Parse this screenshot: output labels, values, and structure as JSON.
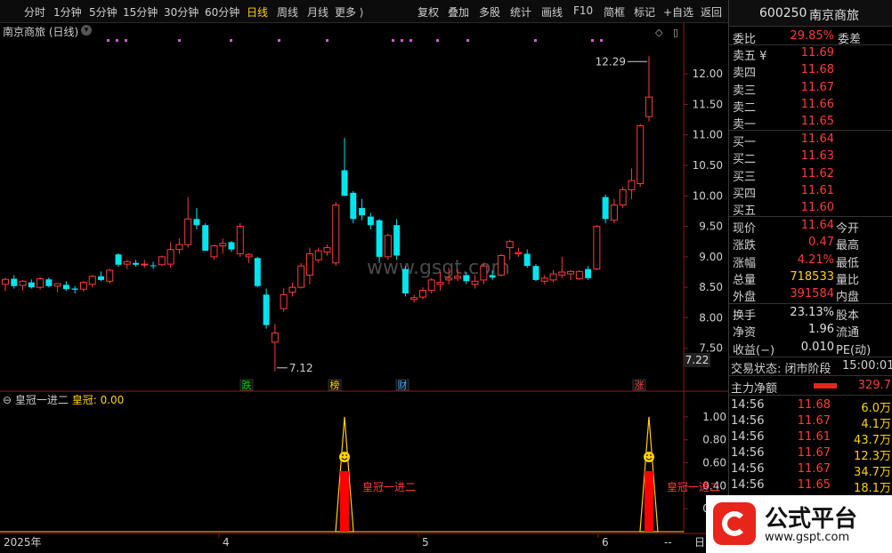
{
  "toolbar": {
    "items": [
      {
        "label": "分时",
        "x": 27
      },
      {
        "label": "1分钟",
        "x": 60
      },
      {
        "label": "5分钟",
        "x": 100
      },
      {
        "label": "15分钟",
        "x": 138
      },
      {
        "label": "30分钟",
        "x": 184
      },
      {
        "label": "60分钟",
        "x": 230
      },
      {
        "label": "日线",
        "x": 277,
        "active": true
      },
      {
        "label": "周线",
        "x": 311
      },
      {
        "label": "月线",
        "x": 345
      },
      {
        "label": "更多 ⟩",
        "x": 376
      },
      {
        "label": "复权",
        "x": 469
      },
      {
        "label": "叠加",
        "x": 503
      },
      {
        "label": "多股",
        "x": 538
      },
      {
        "label": "统计",
        "x": 573
      },
      {
        "label": "画线",
        "x": 608
      },
      {
        "label": "F10",
        "x": 644
      },
      {
        "label": "简框",
        "x": 678
      },
      {
        "label": "标记",
        "x": 712
      },
      {
        "label": "+自选",
        "x": 745
      },
      {
        "label": "返回",
        "x": 787
      }
    ]
  },
  "chart": {
    "title": "南京商旅 (日线)",
    "high_label": "12.29",
    "low_label": "7.12",
    "last_price_label": "7.22",
    "watermark": "www.gsgt.com",
    "markers": [
      {
        "label": "跌",
        "color": "#00d200"
      },
      {
        "label": "榜",
        "color": "#ffd200"
      },
      {
        "label": "财",
        "color": "#3aa8ff"
      },
      {
        "label": "涨",
        "color": "#ff3b3b"
      }
    ],
    "indicator_name": "皇冠一进二",
    "indicator_value_label": "皇冠: 0.00",
    "signal_text": "皇冠一进二",
    "x_labels": [
      "2025年",
      "4",
      "5",
      "6"
    ],
    "bottom_right": [
      "--",
      "日"
    ]
  },
  "chart_data": [
    {
      "type": "candlestick",
      "title": "南京商旅 (日线)",
      "ylim": [
        7.0,
        12.6
      ],
      "y_ticks": [
        7.5,
        8.0,
        8.5,
        9.0,
        9.5,
        10.0,
        10.5,
        11.0,
        11.5,
        12.0
      ],
      "candles": [
        {
          "o": 8.55,
          "h": 8.66,
          "l": 8.44,
          "c": 8.63
        },
        {
          "o": 8.64,
          "h": 8.7,
          "l": 8.48,
          "c": 8.52
        },
        {
          "o": 8.53,
          "h": 8.62,
          "l": 8.45,
          "c": 8.6
        },
        {
          "o": 8.58,
          "h": 8.63,
          "l": 8.48,
          "c": 8.5
        },
        {
          "o": 8.5,
          "h": 8.67,
          "l": 8.46,
          "c": 8.64
        },
        {
          "o": 8.63,
          "h": 8.66,
          "l": 8.5,
          "c": 8.52
        },
        {
          "o": 8.52,
          "h": 8.57,
          "l": 8.42,
          "c": 8.56
        },
        {
          "o": 8.54,
          "h": 8.6,
          "l": 8.44,
          "c": 8.47
        },
        {
          "o": 8.48,
          "h": 8.52,
          "l": 8.4,
          "c": 8.46
        },
        {
          "o": 8.47,
          "h": 8.6,
          "l": 8.43,
          "c": 8.58
        },
        {
          "o": 8.55,
          "h": 8.7,
          "l": 8.5,
          "c": 8.68
        },
        {
          "o": 8.68,
          "h": 8.76,
          "l": 8.6,
          "c": 8.62
        },
        {
          "o": 8.6,
          "h": 8.8,
          "l": 8.56,
          "c": 8.78
        },
        {
          "o": 9.04,
          "h": 9.06,
          "l": 8.84,
          "c": 8.87
        },
        {
          "o": 8.88,
          "h": 8.95,
          "l": 8.8,
          "c": 8.92
        },
        {
          "o": 8.9,
          "h": 8.95,
          "l": 8.84,
          "c": 8.87
        },
        {
          "o": 8.87,
          "h": 8.95,
          "l": 8.82,
          "c": 8.88
        },
        {
          "o": 8.86,
          "h": 8.92,
          "l": 8.8,
          "c": 8.85
        },
        {
          "o": 8.87,
          "h": 9.02,
          "l": 8.85,
          "c": 9.0
        },
        {
          "o": 8.88,
          "h": 9.24,
          "l": 8.82,
          "c": 9.12
        },
        {
          "o": 9.12,
          "h": 9.3,
          "l": 9.05,
          "c": 9.2
        },
        {
          "o": 9.2,
          "h": 9.98,
          "l": 9.15,
          "c": 9.62
        },
        {
          "o": 9.62,
          "h": 9.8,
          "l": 9.45,
          "c": 9.52
        },
        {
          "o": 9.52,
          "h": 9.55,
          "l": 9.1,
          "c": 9.1
        },
        {
          "o": 9.0,
          "h": 9.2,
          "l": 8.95,
          "c": 9.18
        },
        {
          "o": 9.18,
          "h": 9.3,
          "l": 9.05,
          "c": 9.22
        },
        {
          "o": 9.24,
          "h": 9.26,
          "l": 9.08,
          "c": 9.12
        },
        {
          "o": 9.05,
          "h": 9.55,
          "l": 9.0,
          "c": 9.5
        },
        {
          "o": 9.0,
          "h": 9.06,
          "l": 8.9,
          "c": 9.04
        },
        {
          "o": 8.98,
          "h": 9.0,
          "l": 8.5,
          "c": 8.52
        },
        {
          "o": 8.38,
          "h": 8.48,
          "l": 7.82,
          "c": 7.88
        },
        {
          "o": 7.6,
          "h": 7.9,
          "l": 7.12,
          "c": 7.75
        },
        {
          "o": 8.15,
          "h": 8.48,
          "l": 8.1,
          "c": 8.38
        },
        {
          "o": 8.42,
          "h": 8.58,
          "l": 8.35,
          "c": 8.5
        },
        {
          "o": 8.5,
          "h": 8.9,
          "l": 8.48,
          "c": 8.85
        },
        {
          "o": 8.7,
          "h": 9.15,
          "l": 8.55,
          "c": 9.05
        },
        {
          "o": 8.95,
          "h": 9.15,
          "l": 8.9,
          "c": 9.1
        },
        {
          "o": 9.08,
          "h": 9.2,
          "l": 9.02,
          "c": 9.15
        },
        {
          "o": 8.9,
          "h": 9.9,
          "l": 8.85,
          "c": 9.85
        },
        {
          "o": 10.42,
          "h": 10.95,
          "l": 10.12,
          "c": 10.0
        },
        {
          "o": 10.05,
          "h": 10.08,
          "l": 9.55,
          "c": 9.62
        },
        {
          "o": 9.8,
          "h": 9.95,
          "l": 9.6,
          "c": 9.68
        },
        {
          "o": 9.66,
          "h": 9.72,
          "l": 9.45,
          "c": 9.52
        },
        {
          "o": 9.6,
          "h": 9.62,
          "l": 8.9,
          "c": 9.0
        },
        {
          "o": 9.0,
          "h": 9.38,
          "l": 8.95,
          "c": 9.35
        },
        {
          "o": 9.52,
          "h": 9.62,
          "l": 8.95,
          "c": 9.02
        },
        {
          "o": 8.8,
          "h": 8.85,
          "l": 8.35,
          "c": 8.4
        },
        {
          "o": 8.3,
          "h": 8.38,
          "l": 8.25,
          "c": 8.33
        },
        {
          "o": 8.34,
          "h": 8.5,
          "l": 8.3,
          "c": 8.45
        },
        {
          "o": 8.45,
          "h": 8.65,
          "l": 8.4,
          "c": 8.62
        },
        {
          "o": 8.55,
          "h": 8.75,
          "l": 8.45,
          "c": 8.58
        },
        {
          "o": 8.62,
          "h": 8.82,
          "l": 8.55,
          "c": 8.65
        },
        {
          "o": 8.65,
          "h": 8.8,
          "l": 8.6,
          "c": 8.68
        },
        {
          "o": 8.7,
          "h": 8.75,
          "l": 8.55,
          "c": 8.6
        },
        {
          "o": 8.55,
          "h": 8.7,
          "l": 8.48,
          "c": 8.6
        },
        {
          "o": 8.62,
          "h": 8.9,
          "l": 8.55,
          "c": 8.85
        },
        {
          "o": 8.7,
          "h": 8.78,
          "l": 8.62,
          "c": 8.66
        },
        {
          "o": 8.7,
          "h": 9.05,
          "l": 8.68,
          "c": 9.02
        },
        {
          "o": 9.15,
          "h": 9.28,
          "l": 8.95,
          "c": 9.25
        },
        {
          "o": 9.05,
          "h": 9.15,
          "l": 9.0,
          "c": 9.07
        },
        {
          "o": 9.05,
          "h": 9.12,
          "l": 8.82,
          "c": 8.85
        },
        {
          "o": 8.85,
          "h": 8.88,
          "l": 8.6,
          "c": 8.62
        },
        {
          "o": 8.6,
          "h": 8.7,
          "l": 8.55,
          "c": 8.65
        },
        {
          "o": 8.62,
          "h": 8.78,
          "l": 8.58,
          "c": 8.72
        },
        {
          "o": 8.7,
          "h": 9.0,
          "l": 8.65,
          "c": 8.75
        },
        {
          "o": 8.72,
          "h": 8.78,
          "l": 8.62,
          "c": 8.76
        },
        {
          "o": 8.64,
          "h": 8.78,
          "l": 8.62,
          "c": 8.76
        },
        {
          "o": 8.8,
          "h": 8.85,
          "l": 8.62,
          "c": 8.65
        },
        {
          "o": 8.8,
          "h": 9.52,
          "l": 8.78,
          "c": 9.5
        },
        {
          "o": 9.98,
          "h": 10.02,
          "l": 9.55,
          "c": 9.62
        },
        {
          "o": 9.6,
          "h": 9.95,
          "l": 9.55,
          "c": 9.85
        },
        {
          "o": 9.85,
          "h": 10.15,
          "l": 9.8,
          "c": 10.1
        },
        {
          "o": 10.1,
          "h": 10.45,
          "l": 9.95,
          "c": 10.25
        },
        {
          "o": 10.2,
          "h": 11.18,
          "l": 10.15,
          "c": 11.15
        },
        {
          "o": 11.3,
          "h": 12.29,
          "l": 11.22,
          "c": 11.62
        }
      ]
    },
    {
      "type": "line",
      "title": "皇冠一进二",
      "ylim": [
        0,
        1.1
      ],
      "y_ticks": [
        1.0,
        0.8,
        0.6,
        0.4,
        0.2
      ],
      "signal_indices": [
        39,
        74
      ],
      "series": [
        {
          "name": "皇冠",
          "signal_value": 1.0,
          "current": 0.0
        }
      ]
    }
  ],
  "order_book": {
    "code": "600250",
    "name": "南京商旅",
    "weibi_label": "委比",
    "weibi_value": "29.85%",
    "weicha_label": "委差",
    "sell": [
      {
        "label": "卖五 ¥",
        "price": "11.69"
      },
      {
        "label": "卖四",
        "price": "11.68"
      },
      {
        "label": "卖三",
        "price": "11.67"
      },
      {
        "label": "卖二",
        "price": "11.66"
      },
      {
        "label": "卖一",
        "price": "11.65"
      }
    ],
    "buy": [
      {
        "label": "买一",
        "price": "11.64"
      },
      {
        "label": "买二",
        "price": "11.63"
      },
      {
        "label": "买三",
        "price": "11.62"
      },
      {
        "label": "买四",
        "price": "11.61"
      },
      {
        "label": "买五",
        "price": "11.60"
      }
    ]
  },
  "quote": {
    "rows": [
      {
        "l1": "现价",
        "v1": "11.64",
        "c1": "red",
        "l2": "今开"
      },
      {
        "l1": "涨跌",
        "v1": "0.47",
        "c1": "red",
        "l2": "最高"
      },
      {
        "l1": "涨幅",
        "v1": "4.21%",
        "c1": "red",
        "l2": "最低"
      },
      {
        "l1": "总量",
        "v1": "718533",
        "c1": "yellow",
        "l2": "量比"
      },
      {
        "l1": "外盘",
        "v1": "391584",
        "c1": "red",
        "l2": "内盘"
      }
    ],
    "rows2": [
      {
        "l1": "换手",
        "v1": "23.13%",
        "c1": "white",
        "l2": "股本"
      },
      {
        "l1": "净资",
        "v1": "1.96",
        "c1": "white",
        "l2": "流通"
      },
      {
        "l1": "收益(−)",
        "v1": "0.010",
        "c1": "white",
        "l2": "PE(动)"
      }
    ],
    "status_label": "交易状态: 闭市阶段",
    "status_time": "15:00:01",
    "main_flow_label": "主力净额",
    "main_flow_value": "329.7"
  },
  "trades": [
    {
      "time": "14:56",
      "price": "11.68",
      "vol": "6.0万"
    },
    {
      "time": "14:56",
      "price": "11.67",
      "vol": "4.1万"
    },
    {
      "time": "14:56",
      "price": "11.61",
      "vol": "43.7万"
    },
    {
      "time": "14:56",
      "price": "11.67",
      "vol": "12.3万"
    },
    {
      "time": "14:56",
      "price": "11.67",
      "vol": "34.7万"
    },
    {
      "time": "14:56",
      "price": "11.65",
      "vol": "18.1万"
    }
  ],
  "logo": {
    "text": "公式平台",
    "url": "www.gspt.com"
  },
  "colors": {
    "up": "#ff3b3b",
    "down": "#00e5ee",
    "axis": "#8b1a1a",
    "signal_fill": "#ff0000",
    "signal_line": "#ffd200"
  }
}
